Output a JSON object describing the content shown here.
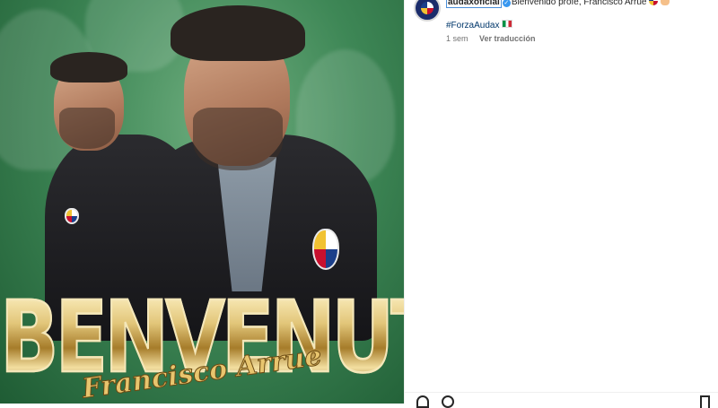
{
  "post": {
    "banner_word": "BENVENUTO",
    "banner_name": "Francisco Arrue",
    "image_colors": {
      "background": "#3e8756",
      "gold": "#e2c67a"
    }
  },
  "caption": {
    "username": "audaxoficial",
    "verified": true,
    "text": "Bienvenido profe, Francisco Arrue",
    "emoji": [
      "crest-emoji",
      "hands-emoji"
    ],
    "hashtag": "#ForzaAudax",
    "hashtag_emoji": "italy-flag-emoji",
    "time_ago": "1 sem",
    "translate_label": "Ver traducción"
  },
  "actions": {
    "icons": [
      "heart-icon",
      "comment-icon",
      "bookmark-icon"
    ]
  }
}
